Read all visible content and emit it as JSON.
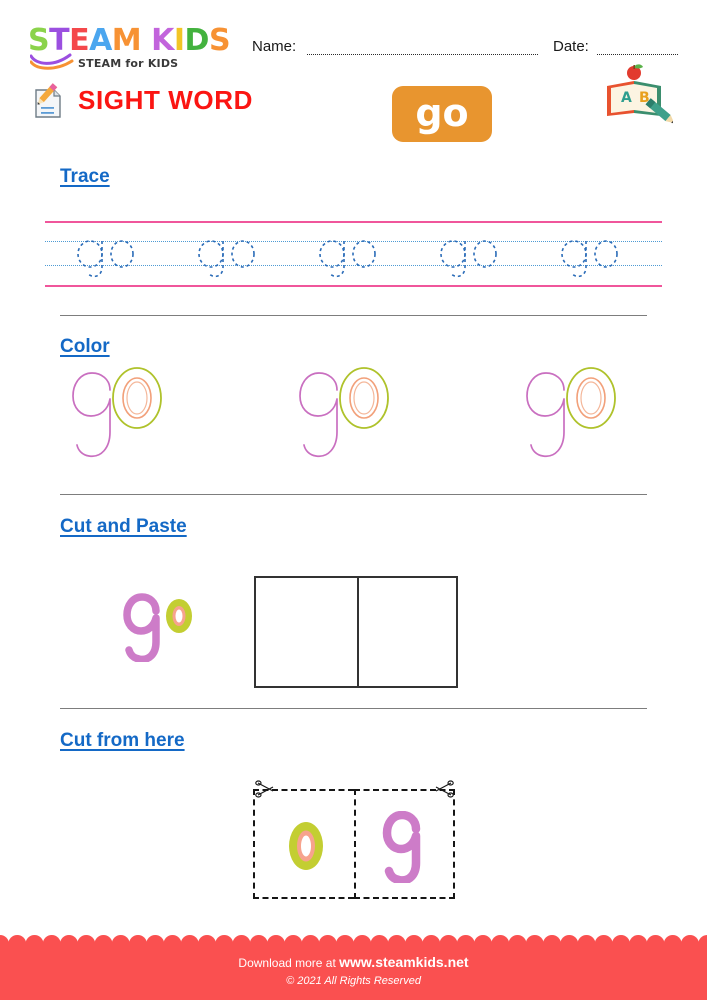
{
  "brand": {
    "logo_letters": [
      {
        "ch": "S",
        "color": "#8BD34B"
      },
      {
        "ch": "T",
        "color": "#9B4FE0"
      },
      {
        "ch": "E",
        "color": "#F4484B"
      },
      {
        "ch": "A",
        "color": "#4BA6EF"
      },
      {
        "ch": "M",
        "color": "#F79234"
      },
      {
        "ch": " ",
        "color": "#ffffff"
      },
      {
        "ch": "K",
        "color": "#C264DC"
      },
      {
        "ch": "I",
        "color": "#F2C525"
      },
      {
        "ch": "D",
        "color": "#43B23E"
      },
      {
        "ch": "S",
        "color": "#F79234"
      }
    ],
    "logo_word": "STEAM KIDS",
    "tagline": "STEAM for KIDS"
  },
  "header": {
    "name_label": "Name:",
    "date_label": "Date:",
    "title": "SIGHT WORD",
    "title_color": "#FB1512",
    "badge_word": "go",
    "badge_color": "#E8952F",
    "memo_icon": "memo-pencil-icon",
    "book_icon": "open-book-apple-pencil-icon"
  },
  "sections": [
    {
      "id": "trace",
      "heading": "Trace"
    },
    {
      "id": "color",
      "heading": "Color"
    },
    {
      "id": "cut-and-paste",
      "heading": "Cut and Paste"
    },
    {
      "id": "cut-from-here",
      "heading": "Cut from here"
    }
  ],
  "trace": {
    "word": "go",
    "repetitions": 5,
    "line_color_pink": "#F0569B",
    "line_color_blue": "#4E9BD4",
    "stroke_color": "#2B6CB8"
  },
  "color_section": {
    "word": "go",
    "repetitions": 3,
    "g_outline_color": "#C96FC0",
    "o_outline_color": "#AFC22B",
    "o_inner_color": "#F2A07A"
  },
  "cut_and_paste": {
    "word": "go",
    "g_color": "#CD7CC8",
    "o_color": "#C3CE32",
    "o_inner_color": "#F7A38D",
    "boxes": 2,
    "box_border_color": "#333333"
  },
  "cut_from_here": {
    "cards": [
      {
        "letter": "o",
        "color": "#C3CE32",
        "inner_color": "#F7A38D"
      },
      {
        "letter": "g",
        "color": "#CD7CC8",
        "inner_color": ""
      }
    ],
    "scissors_icon": "scissors-icon",
    "border_style": "dashed"
  },
  "footer": {
    "download_text": "Download more at",
    "site": "www.steamkids.net",
    "copyright": "© 2021 All Rights Reserved",
    "background_color": "#FA5050"
  },
  "accents": {
    "heading_blue": "#1469C6",
    "divider_gray": "#7d7d7d"
  }
}
